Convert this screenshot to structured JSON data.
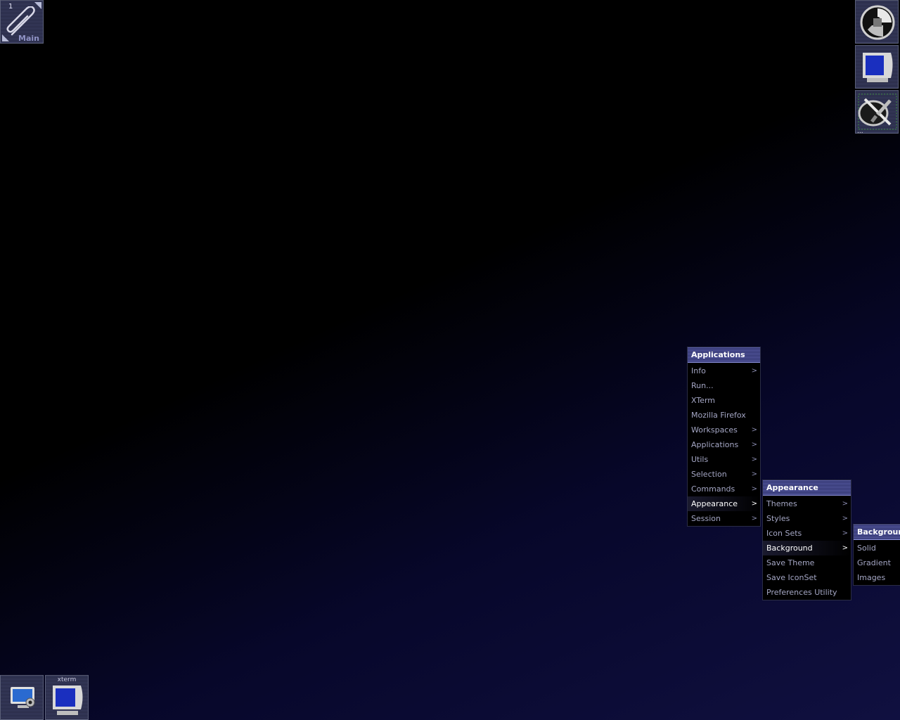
{
  "clip": {
    "workspace_number": "1",
    "workspace_name": "Main"
  },
  "dock": {
    "items": [
      {
        "icon": "wmaker-logo-icon"
      },
      {
        "icon": "monitor-icon"
      },
      {
        "icon": "preferences-tools-icon",
        "label": "..."
      }
    ]
  },
  "bottom_icons": [
    {
      "icon": "screenshot-monitor-icon"
    },
    {
      "icon": "xterm-monitor-icon",
      "label": "xterm"
    }
  ],
  "menus": {
    "root": {
      "title": "Applications",
      "items": [
        {
          "label": "Info",
          "submenu": true
        },
        {
          "label": "Run...",
          "submenu": false
        },
        {
          "label": "XTerm",
          "submenu": false
        },
        {
          "label": "Mozilla Firefox",
          "submenu": false
        },
        {
          "label": "Workspaces",
          "submenu": true
        },
        {
          "label": "Applications",
          "submenu": true
        },
        {
          "label": "Utils",
          "submenu": true
        },
        {
          "label": "Selection",
          "submenu": true
        },
        {
          "label": "Commands",
          "submenu": true
        },
        {
          "label": "Appearance",
          "submenu": true,
          "selected": true
        },
        {
          "label": "Session",
          "submenu": true
        }
      ]
    },
    "appearance": {
      "title": "Appearance",
      "items": [
        {
          "label": "Themes",
          "submenu": true
        },
        {
          "label": "Styles",
          "submenu": true
        },
        {
          "label": "Icon Sets",
          "submenu": true
        },
        {
          "label": "Background",
          "submenu": true,
          "selected": true
        },
        {
          "label": "Save Theme",
          "submenu": false
        },
        {
          "label": "Save IconSet",
          "submenu": false
        },
        {
          "label": "Preferences Utility",
          "submenu": false
        }
      ]
    },
    "background": {
      "title": "Background",
      "items": [
        {
          "label": "Solid",
          "submenu": false
        },
        {
          "label": "Gradient",
          "submenu": false
        },
        {
          "label": "Images",
          "submenu": false
        }
      ]
    }
  },
  "colors": {
    "menu_title_bg": "#2a2d63",
    "menu_text": "#a4a6c4",
    "menu_selected_text": "#ffffff"
  }
}
